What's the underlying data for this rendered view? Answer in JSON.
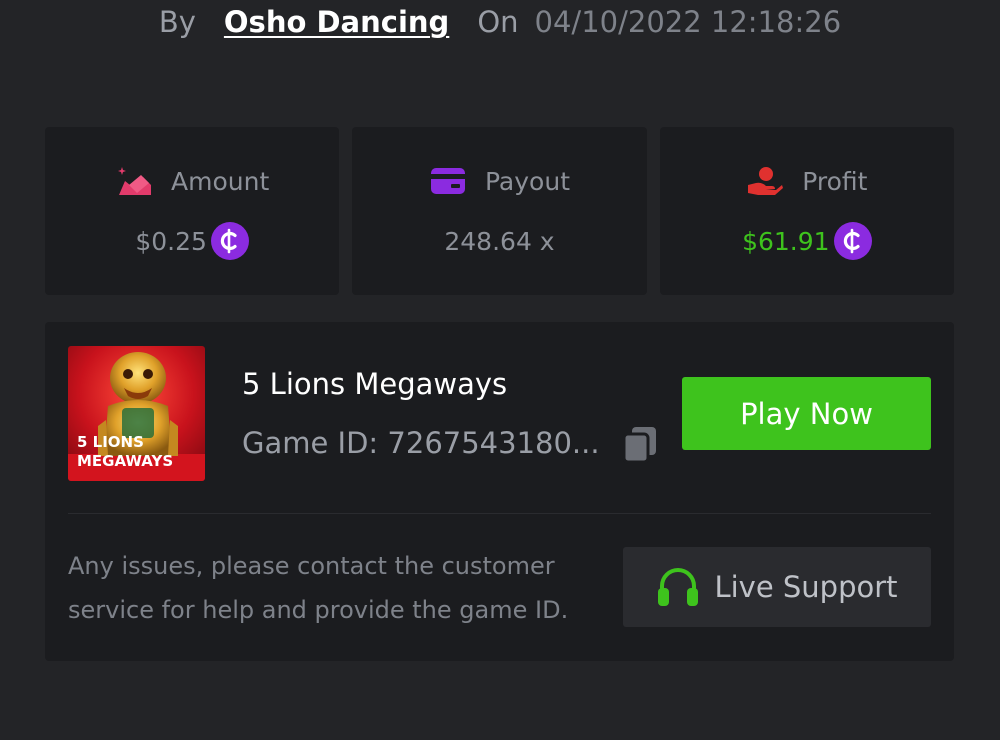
{
  "byline": {
    "by_label": "By",
    "author": "Osho Dancing",
    "on_label": "On",
    "datetime": "04/10/2022 12:18:26"
  },
  "stats": [
    {
      "label": "Amount",
      "value": "$0.25",
      "icon": "amount-icon",
      "coin_icon": "coin-icon",
      "color": "#e23b6b"
    },
    {
      "label": "Payout",
      "value": "248.64 x",
      "icon": "payout-card-icon",
      "color": "#8b2be0"
    },
    {
      "label": "Profit",
      "value": "$61.91",
      "icon": "profit-hand-icon",
      "coin_icon": "coin-icon",
      "color": "#e0312f",
      "value_color": "#3ec31d"
    }
  ],
  "game": {
    "title": "5 Lions Megaways",
    "id_label": "Game ID: 7267543180...",
    "thumbnail_text": "5 LIONS MEGAWAYS",
    "play_label": "Play Now",
    "play_color": "#3ec31d"
  },
  "support": {
    "help_text": "Any issues, please contact the customer service for help and provide the game ID.",
    "button_label": "Live Support",
    "icon": "headset-icon",
    "icon_color": "#3ec31d"
  },
  "colors": {
    "background": "#232427",
    "card": "#1b1c1f",
    "coin": "#8b2be0"
  }
}
